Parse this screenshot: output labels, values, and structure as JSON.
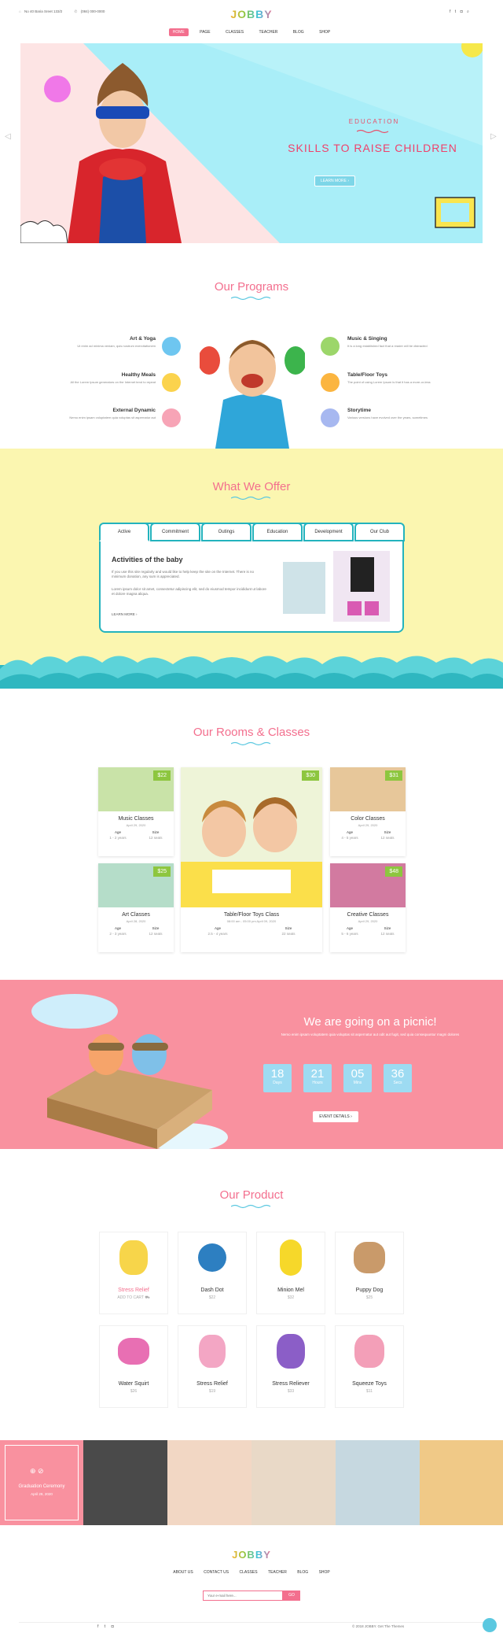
{
  "header": {
    "address": "No 40 Baria Sreet 133/2",
    "phone": "(084) 000-0000",
    "logo": "JOBBY",
    "nav": [
      "HOME",
      "PAGE",
      "CLASSES",
      "TEACHER",
      "BLOG",
      "SHOP"
    ],
    "social_icons": [
      "facebook-icon",
      "twitter-icon",
      "instagram-icon",
      "search-icon"
    ]
  },
  "hero": {
    "eyebrow": "EDUCATION",
    "title": "SKILLS TO RAISE CHILDREN",
    "button": "LEARN MORE"
  },
  "programs": {
    "title": "Our Programs",
    "items": [
      {
        "name": "Art & Yoga",
        "desc": "Ut enim ad minima veniam, quis nostrum exercitationem",
        "color": "#6ec6f0"
      },
      {
        "name": "Healthy Meals",
        "desc": "All the Lorem Ipsum generators on the Internet tend to repeat",
        "color": "#fbd34d"
      },
      {
        "name": "External Dynamic",
        "desc": "Nemo enim ipsam voluptatem quia voluptas sit aspernatur aut",
        "color": "#f7a4b6"
      },
      {
        "name": "Music & Singing",
        "desc": "It is a long established fact that a reader will be distracted",
        "color": "#9cd66a"
      },
      {
        "name": "Table/Floor Toys",
        "desc": "The point of using Lorem Ipsum is that it has a more-or-less",
        "color": "#fbb540"
      },
      {
        "name": "Storytime",
        "desc": "Various versions have evolved over the years, sometimes",
        "color": "#a7b8f0"
      }
    ]
  },
  "offer": {
    "title": "What We Offer",
    "tabs": [
      "Active",
      "Commitment",
      "Outings",
      "Education",
      "Development",
      "Our Club"
    ],
    "heading": "Activities of the baby",
    "p1": "If you use this site regularly and would like to help keep the site on the Internet. There is no minimum donation, any sum is appreciated.",
    "p2": "Lorem ipsum dolor sit amet, consectetur adipiscing elit, sed do eiusmod tempor incididunt ut labore et dolore magna aliqua.",
    "link": "LEARN MORE"
  },
  "rooms": {
    "title": "Our Rooms & Classes",
    "cards": [
      {
        "title": "Music Classes",
        "date": "April 29, 2020",
        "price": "$22",
        "age": "1 - 2 years",
        "size": "12 seats",
        "color": "#c9e3a8"
      },
      {
        "title": "Color Classes",
        "date": "April 29, 2020",
        "price": "$31",
        "age": "4 - 5 years",
        "size": "12 seats",
        "color": "#e7c79a"
      },
      {
        "title": "Art Classes",
        "date": "April 28, 2020",
        "price": "$25",
        "age": "2 - 3 years",
        "size": "12 seats",
        "color": "#b5ddc9"
      },
      {
        "title": "Creative Classes",
        "date": "April 29, 2020",
        "price": "$48",
        "age": "5 - 6 years",
        "size": "12 seats",
        "color": "#d27aa0"
      }
    ],
    "featured": {
      "title": "Table/Floor Toys Class",
      "date": "08:00 am - 05:00 pm   April 09, 2020",
      "price": "$30",
      "age": "2.5 - 4 years",
      "size": "22 seats"
    },
    "age_label": "Age",
    "size_label": "Size"
  },
  "picnic": {
    "title": "We are going on a picnic!",
    "desc": "Nemo enim ipsam voluptatem quia voluptas sit aspernatur aut odit aut fugit, sed quia consequuntur magni dolores",
    "countdown": [
      {
        "n": "18",
        "l": "Days"
      },
      {
        "n": "21",
        "l": "Hours"
      },
      {
        "n": "05",
        "l": "Mins"
      },
      {
        "n": "36",
        "l": "Secs"
      }
    ],
    "button": "EVENT DETAILS"
  },
  "products": {
    "title": "Our Product",
    "items": [
      {
        "name": "Stress Relief",
        "price": "ADD TO CART",
        "color": "#f7d54a",
        "highlight": true
      },
      {
        "name": "Dash Dot",
        "price": "$22",
        "color": "#2d7fc1"
      },
      {
        "name": "Minion Mel",
        "price": "$32",
        "color": "#f6d82a"
      },
      {
        "name": "Puppy Dog",
        "price": "$25",
        "color": "#c99a6a"
      },
      {
        "name": "Water Squirt",
        "price": "$26",
        "color": "#e86fb3"
      },
      {
        "name": "Stress Relief",
        "price": "$19",
        "color": "#f3a6c4"
      },
      {
        "name": "Stress Reliever",
        "price": "$33",
        "color": "#8b5ec7"
      },
      {
        "name": "Squeeze Toys",
        "price": "$11",
        "color": "#f39fb8"
      }
    ]
  },
  "gallery": {
    "event": "Graduation Ceremony",
    "date": "April 29, 2020",
    "photos": [
      "#4a4a4a",
      "#f2d7c4",
      "#e9d9c7",
      "#c6d8e0",
      "#f0c987"
    ]
  },
  "footer": {
    "logo": "JOBBY",
    "nav": [
      "ABOUT US",
      "CONTACT US",
      "CLASSES",
      "TEACHER",
      "BLOG",
      "SHOP"
    ],
    "placeholder": "Your e-mail here...",
    "button": "GO",
    "copyright": "© 2018 JOBBY. Get The Themes"
  }
}
